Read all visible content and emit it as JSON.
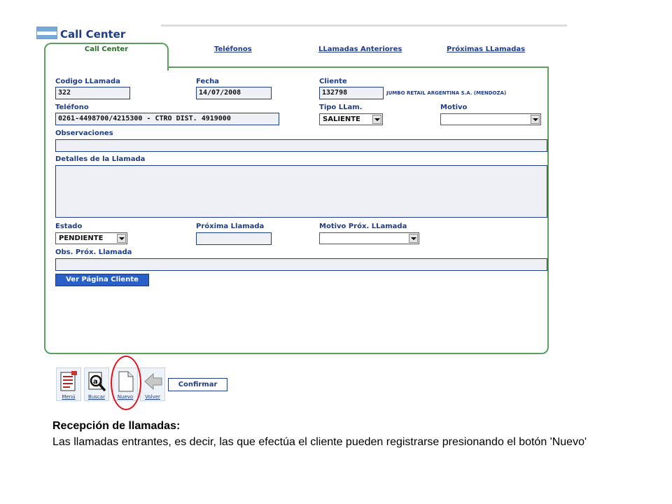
{
  "app": {
    "title": "Call Center"
  },
  "tabs": [
    {
      "label": "Call Center",
      "active": true
    },
    {
      "label": "Teléfonos"
    },
    {
      "label": "LLamadas Anteriores"
    },
    {
      "label": "Próximas LLamadas"
    }
  ],
  "form": {
    "codigo": {
      "label": "Codigo LLamada",
      "value": "322"
    },
    "fecha": {
      "label": "Fecha",
      "value": "14/07/2008"
    },
    "cliente": {
      "label": "Cliente",
      "value": "132798",
      "name": "JUMBO RETAIL ARGENTINA S.A. (MENDOZA)"
    },
    "telefono": {
      "label": "Teléfono",
      "value": "0261-4498700/4215300 - CTRO DIST. 4919000"
    },
    "tipo": {
      "label": "Tipo LLam.",
      "value": "SALIENTE"
    },
    "motivo": {
      "label": "Motivo",
      "value": ""
    },
    "observaciones": {
      "label": "Observaciones",
      "value": ""
    },
    "detalles": {
      "label": "Detalles de la Llamada",
      "value": ""
    },
    "estado": {
      "label": "Estado",
      "value": "PENDIENTE"
    },
    "proxima": {
      "label": "Próxima Llamada",
      "value": ""
    },
    "motivo_prox": {
      "label": "Motivo Próx. LLamada",
      "value": ""
    },
    "obs_prox": {
      "label": "Obs. Próx. Llamada",
      "value": ""
    },
    "ver_cliente_button": "Ver Página Cliente"
  },
  "toolbar": {
    "menu": "Menú",
    "buscar": "Buscar",
    "nuevo": "Nuevo",
    "volver": "Volver",
    "confirmar": "Confirmar"
  },
  "caption": {
    "title": "Recepción de llamadas:",
    "body": "Las llamadas entrantes, es decir, las que efectúa el cliente pueden registrarse presionando el botón 'Nuevo'"
  },
  "colors": {
    "accent": "#1f3c88",
    "tab_border": "#5aa05a",
    "highlight": "#e0141e",
    "button": "#2a5fc7"
  }
}
